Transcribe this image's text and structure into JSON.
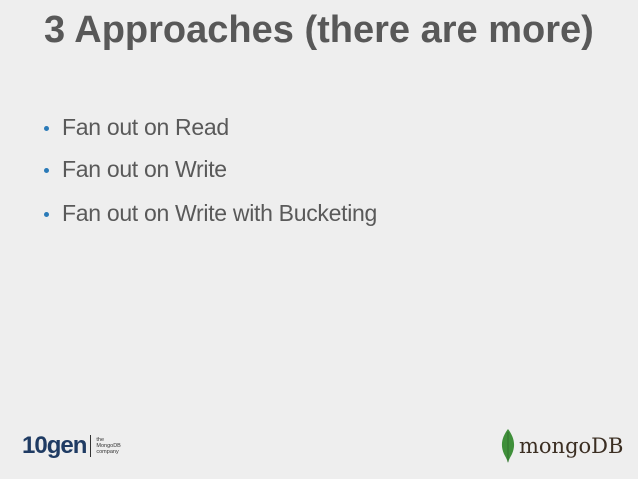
{
  "slide": {
    "title": "3 Approaches (there are more)",
    "bullets": [
      "Fan out on Read",
      "Fan out on Write",
      "Fan out on Write with Bucketing"
    ],
    "bullet_color": "#2a7ab8"
  },
  "footer": {
    "left_logo": {
      "word": "10gen",
      "tagline_1": "the",
      "tagline_2": "MongoDB",
      "tagline_3": "company"
    },
    "right_logo": {
      "word": "mongoDB",
      "icon": "leaf-icon",
      "leaf_color": "#3f8f3a"
    }
  }
}
